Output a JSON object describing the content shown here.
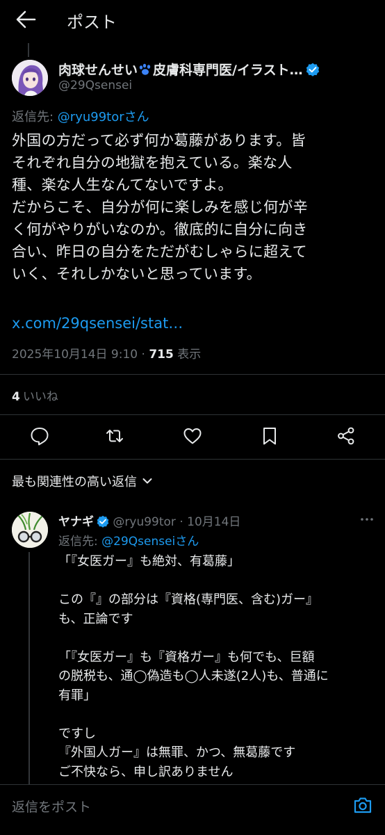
{
  "header": {
    "title": "ポスト"
  },
  "post": {
    "author_name": "肉球せんせい",
    "author_name_rest": "皮膚科専門医/イラスト…",
    "handle": "@29Qsensei",
    "reply_to_label": "返信先: ",
    "reply_to_handle": "@ryu99torさん",
    "body": "外国の方だって必ず何か葛藤があります。皆\nそれぞれ自分の地獄を抱えている。楽な人\n種、楽な人生なんてないですよ。\nだからこそ、自分が何に楽しみを感じ何が辛\nく何がやりがいなのか。徹底的に自分に向き\n合い、昨日の自分をただがむしゃらに超えて\nいく、それしかないと思っています。",
    "link": "x.com/29qsensei/stat…",
    "timestamp": "2025年10月14日 9:10 · ",
    "views_count": "715",
    "views_label": " 表示",
    "likes_count": "4",
    "likes_label": "いいね"
  },
  "actions": [
    "reply-icon",
    "repost-icon",
    "like-icon",
    "bookmark-icon",
    "share-icon"
  ],
  "sort": {
    "label": "最も関連性の高い返信"
  },
  "reply": {
    "name": "ヤナギ",
    "handle_date": " @ryu99tor · 10月14日",
    "reply_to_label": "返信先: ",
    "reply_to_handle": "@29Qsenseiさん",
    "body": "「『女医ガー』も絶対、有葛藤」\n\nこの『』の部分は『資格(専門医、含む)ガー』\nも、正論です\n\n「『女医ガー』も『資格ガー』も何でも、巨額\nの脱税も、通◯偽造も◯人未遂(2人)も、普通に\n有罪」\n\nですし\n『外国人ガー』は無罪、かつ、無葛藤です\nご不快なら、申し訳ありません"
  },
  "compose": {
    "placeholder": "返信をポスト"
  },
  "colors": {
    "background": "#000000",
    "text": "#e7e9ea",
    "muted": "#71767b",
    "accent": "#1d9bf0",
    "divider": "#2f3336"
  }
}
